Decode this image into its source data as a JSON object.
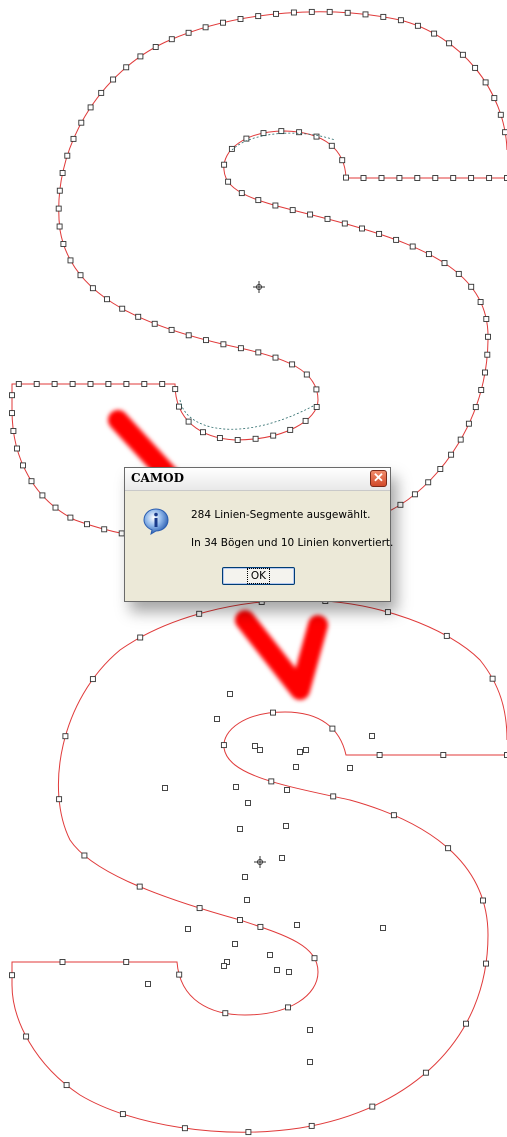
{
  "dialog": {
    "title": "CAMOD",
    "close_symbol": "✕",
    "icon": "info-icon",
    "message_line1": "284 Linien-Segmente ausgewählt.",
    "message_line2": "In 34 Bögen und 10 Linien konvertiert.",
    "ok_label": "OK"
  },
  "colors": {
    "contour": "#e03a3a",
    "arrow": "#ff0000",
    "node_fill": "#ffffff",
    "node_stroke": "#333333",
    "dialog_bg": "#ece9d8"
  }
}
